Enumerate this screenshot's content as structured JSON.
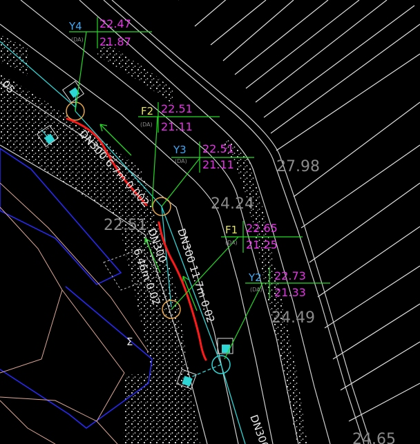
{
  "colors": {
    "background": "#000000",
    "leader": "#22dd22",
    "value": "#e632e6",
    "tag_yellow": "#e6e65a",
    "tag_cyan": "#3fa9f5",
    "markup": "#ff1a1a",
    "pipe": "#2dd5d5",
    "hatch": "#d8d8d8",
    "building": "#2a2aff",
    "roof": "#e0a896"
  },
  "labels": [
    {
      "tag": "Y4",
      "top": "22.47",
      "code": "(DA)",
      "bottom": "21.87"
    },
    {
      "tag": "F2",
      "top": "22.51",
      "code": "(DA)",
      "bottom": "21.11"
    },
    {
      "tag": "Y3",
      "top": "22.51",
      "code": "(DA)",
      "bottom": "21.11"
    },
    {
      "tag": "F1",
      "top": "22.65",
      "code": "(DA)",
      "bottom": "21.25"
    },
    {
      "tag": "Y2",
      "top": "22.73",
      "code": "(DA)",
      "bottom": "21.33"
    }
  ],
  "spot_levels": [
    "27.98",
    "24.24",
    "22.51",
    "24.49",
    "24.65"
  ],
  "pipe_labels": {
    "upper": "DN300 6.7m 0.002",
    "middle": "DN300 11.7m 0.02",
    "side_size": "DN300",
    "side_len": "6.46m 0.02",
    "bottom": "DN300",
    "edge": "05"
  },
  "misc_glyph": "Σ"
}
